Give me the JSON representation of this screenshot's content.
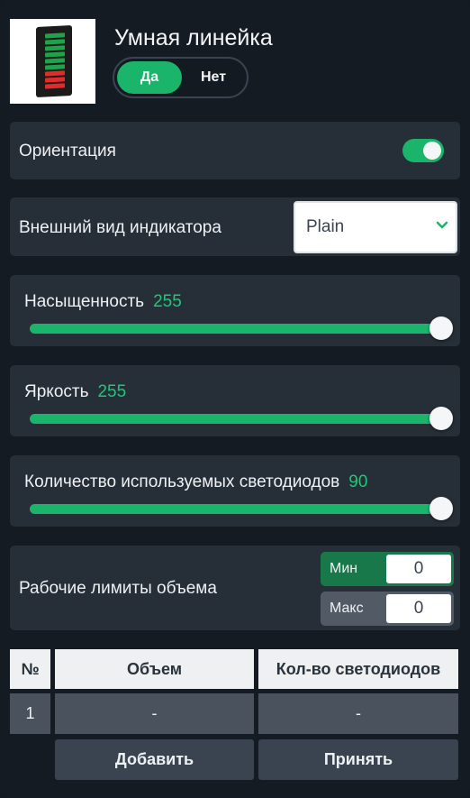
{
  "header": {
    "title": "Умная линейка",
    "toggle": {
      "yes": "Да",
      "no": "Нет",
      "selected": "yes"
    }
  },
  "orientation": {
    "label": "Ориентация",
    "enabled": true
  },
  "indicator_look": {
    "label": "Внешний вид индикатора",
    "value": "Plain"
  },
  "saturation": {
    "label": "Насыщенность",
    "value": "255"
  },
  "brightness": {
    "label": "Яркость",
    "value": "255"
  },
  "led_count": {
    "label": "Количество используемых светодиодов",
    "value": "90"
  },
  "limits": {
    "label": "Рабочие лимиты объема",
    "min_label": "Мин",
    "min_value": "0",
    "max_label": "Макс",
    "max_value": "0"
  },
  "table": {
    "headers": [
      "№",
      "Объем",
      "Кол-во светодиодов"
    ],
    "rows": [
      [
        "1",
        "-",
        "-"
      ]
    ],
    "add_label": "Добавить",
    "accept_label": "Принять"
  },
  "colors": {
    "accent": "#1ab46a",
    "accent_text": "#1ec878",
    "background": "#151b22",
    "card": "#262e37"
  }
}
